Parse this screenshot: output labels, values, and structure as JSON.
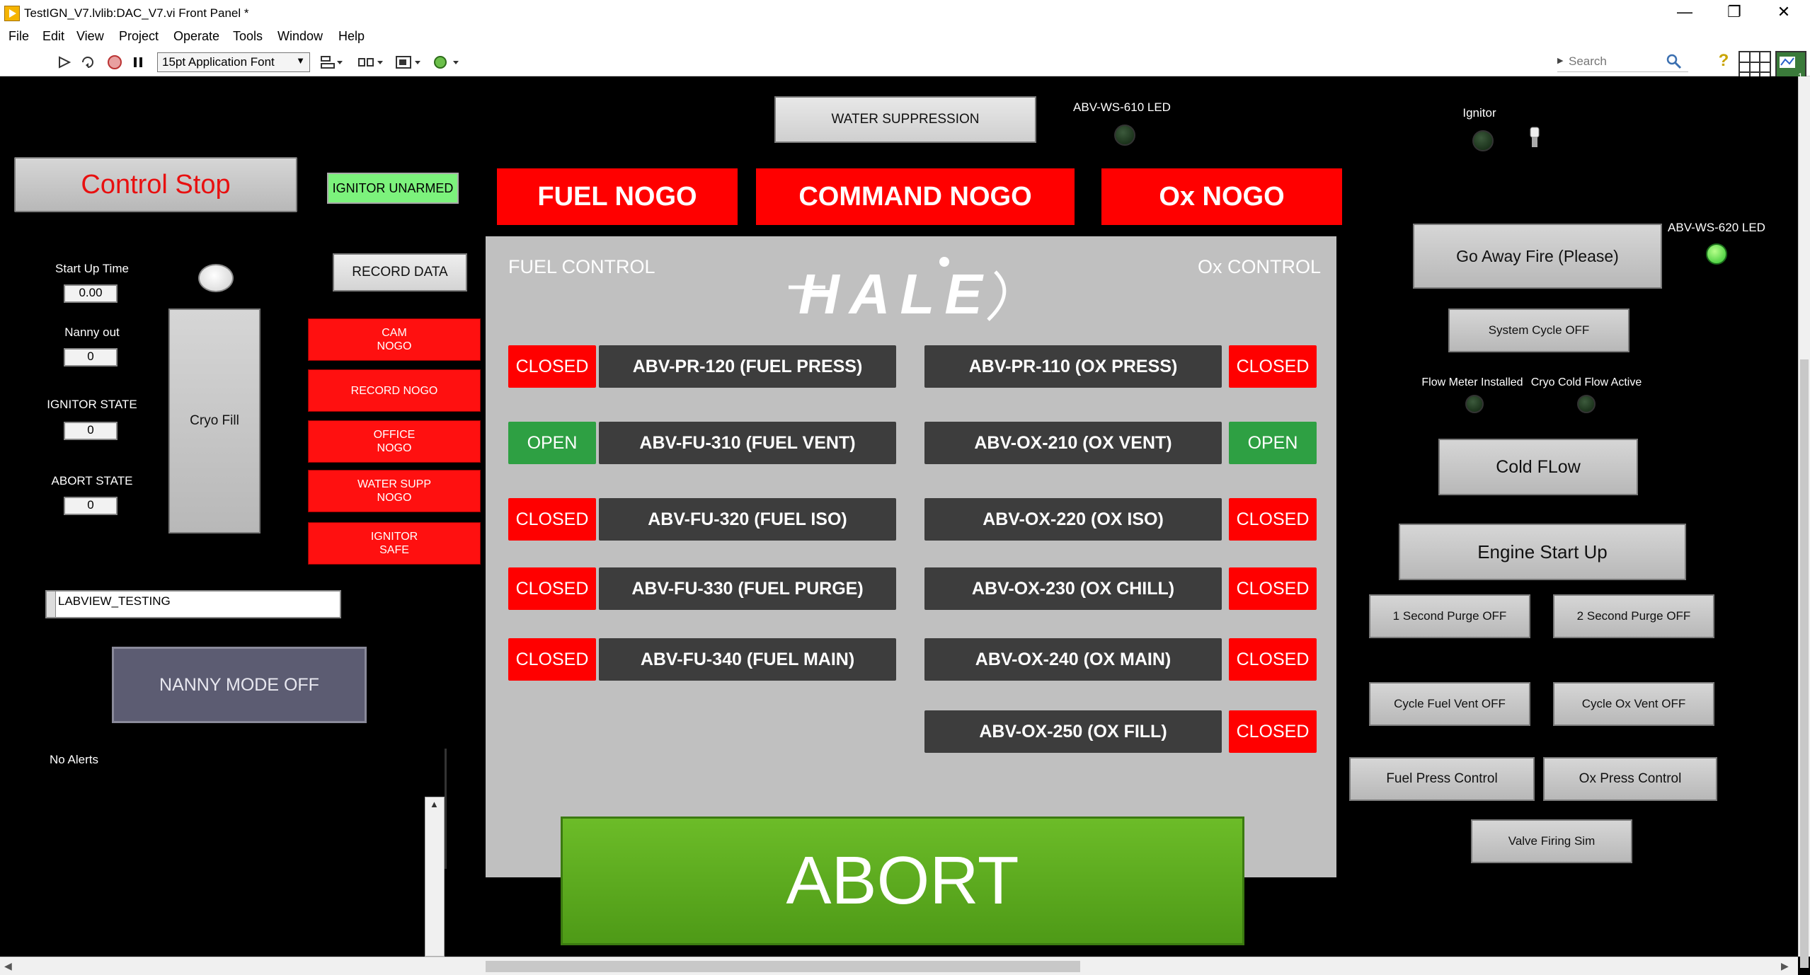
{
  "window": {
    "title": "TestIGN_V7.lvlib:DAC_V7.vi Front Panel *",
    "minimize": "—",
    "restore": "❐",
    "close": "✕"
  },
  "menu": [
    "File",
    "Edit",
    "View",
    "Project",
    "Operate",
    "Tools",
    "Window",
    "Help"
  ],
  "toolbar": {
    "font_select": "15pt Application Font",
    "search_placeholder": "Search",
    "help": "?"
  },
  "colors": {
    "panel_bg": "#000000",
    "red": "#ff0000",
    "green": "#2ea043",
    "abort_green": "#5fa81e",
    "valve_dark": "#3d3d3d",
    "center_gray": "#c0c0c0",
    "armed_indicator": "#7cf27c"
  },
  "left": {
    "control_stop": "Control Stop",
    "ignitor_status": "IGNITOR UNARMED",
    "record_data": "RECORD DATA",
    "startup_label": "Start Up Time",
    "startup_value": "0.00",
    "nanny_label": "Nanny out",
    "nanny_value": "0",
    "ignitor_state_label": "IGNITOR STATE",
    "ignitor_state_value": "0",
    "abort_state_label": "ABORT STATE",
    "abort_state_value": "0",
    "cryo_fill": "Cryo Fill",
    "nogo": [
      {
        "line1": "CAM",
        "line2": "NOGO"
      },
      {
        "line1": "RECORD NOGO",
        "line2": ""
      },
      {
        "line1": "OFFICE",
        "line2": "NOGO"
      },
      {
        "line1": "WATER SUPP",
        "line2": "NOGO"
      },
      {
        "line1": "IGNITOR",
        "line2": "SAFE"
      }
    ],
    "string_value": "LABVIEW_TESTING",
    "nanny_mode": "NANNY MODE OFF",
    "alerts": "No Alerts"
  },
  "top": {
    "water_suppression": "WATER SUPPRESSION",
    "ws610_label": "ABV-WS-610 LED",
    "ignitor_label": "Ignitor",
    "fuel_nogo": "FUEL NOGO",
    "command_nogo": "COMMAND NOGO",
    "ox_nogo": "Ox NOGO"
  },
  "center": {
    "fuel_control": "FUEL CONTROL",
    "ox_control": "Ox CONTROL",
    "logo": "HALE",
    "fuel_valves": [
      {
        "status": "CLOSED",
        "name": "ABV-PR-120 (FUEL PRESS)",
        "open": false
      },
      {
        "status": "OPEN",
        "name": "ABV-FU-310 (FUEL VENT)",
        "open": true
      },
      {
        "status": "CLOSED",
        "name": "ABV-FU-320 (FUEL ISO)",
        "open": false
      },
      {
        "status": "CLOSED",
        "name": "ABV-FU-330 (FUEL PURGE)",
        "open": false
      },
      {
        "status": "CLOSED",
        "name": "ABV-FU-340 (FUEL MAIN)",
        "open": false
      }
    ],
    "ox_valves": [
      {
        "status": "CLOSED",
        "name": "ABV-PR-110 (OX PRESS)",
        "open": false
      },
      {
        "status": "OPEN",
        "name": "ABV-OX-210 (OX VENT)",
        "open": true
      },
      {
        "status": "CLOSED",
        "name": "ABV-OX-220 (OX ISO)",
        "open": false
      },
      {
        "status": "CLOSED",
        "name": "ABV-OX-230 (OX CHILL)",
        "open": false
      },
      {
        "status": "CLOSED",
        "name": "ABV-OX-240 (OX MAIN)",
        "open": false
      },
      {
        "status": "CLOSED",
        "name": "ABV-OX-250 (OX FILL)",
        "open": false
      }
    ]
  },
  "abort": "ABORT",
  "right": {
    "go_away_fire": "Go Away Fire (Please)",
    "ws620_label": "ABV-WS-620 LED",
    "system_cycle": "System Cycle OFF",
    "flow_meter": "Flow Meter Installed",
    "cryo_cold_flow": "Cryo Cold Flow Active",
    "cold_flow": "Cold FLow",
    "engine_startup": "Engine Start Up",
    "purge1": "1 Second Purge OFF",
    "purge2": "2 Second Purge OFF",
    "cycle_fuel_vent": "Cycle Fuel Vent OFF",
    "cycle_ox_vent": "Cycle Ox Vent OFF",
    "fuel_press_control": "Fuel Press Control",
    "ox_press_control": "Ox Press Control",
    "valve_firing_sim": "Valve Firing Sim"
  }
}
